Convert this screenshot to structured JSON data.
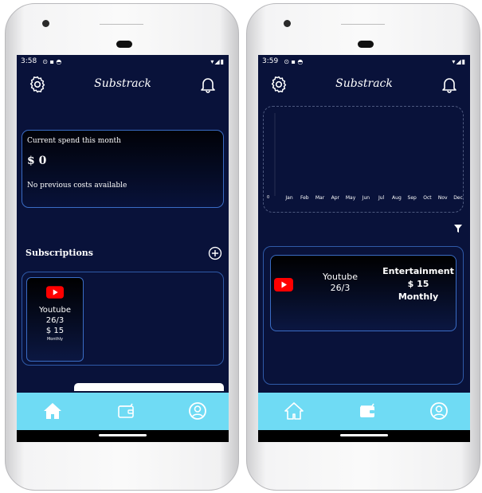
{
  "left": {
    "status": {
      "time": "3:58"
    },
    "app_title": "Substrack",
    "spend": {
      "label": "Current spend this month",
      "amount": "$ 0",
      "note": "No previous costs available"
    },
    "subscriptions_heading": "Subscriptions",
    "subscription": {
      "name": "Youtube",
      "date": "26/3",
      "price": "$ 15",
      "cycle": "Monthly"
    }
  },
  "right": {
    "status": {
      "time": "3:59"
    },
    "app_title": "Substrack",
    "chart_data": {
      "type": "bar",
      "categories": [
        "Jan",
        "Feb",
        "Mar",
        "Apr",
        "May",
        "Jun",
        "Jul",
        "Aug",
        "Sep",
        "Oct",
        "Nov",
        "Dec"
      ],
      "values": [
        0,
        0,
        0,
        0,
        0,
        0,
        0,
        0,
        0,
        0,
        0,
        0
      ],
      "title": "",
      "xlabel": "",
      "ylabel": "",
      "y_tick": "0"
    },
    "subscription": {
      "name": "Youtube",
      "date": "26/3",
      "category": "Entertainment",
      "price": "$ 15",
      "cycle": "Monthly"
    }
  },
  "icons": {
    "settings": "gear-icon",
    "notifications": "bell-icon",
    "add": "plus-circle-icon",
    "youtube": "youtube-icon",
    "home": "home-icon",
    "wallet": "wallet-icon",
    "profile": "user-icon",
    "filter": "filter-icon"
  },
  "colors": {
    "background": "#09123a",
    "card_border": "#3a6cc4",
    "navbar": "#6fdbf4",
    "youtube_red": "#ff0000"
  }
}
